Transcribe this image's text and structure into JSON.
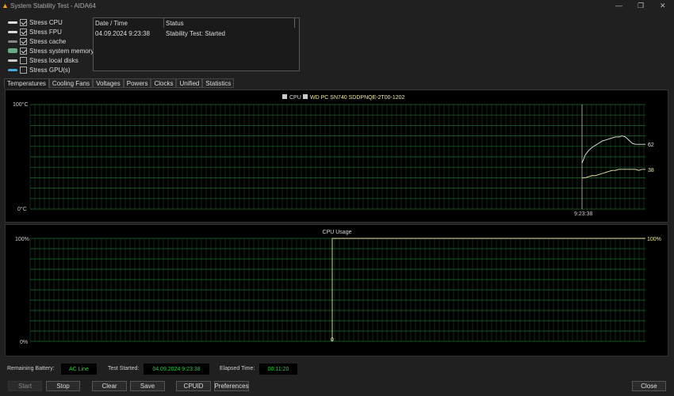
{
  "window": {
    "title": "System Stability Test - AIDA64",
    "minimize": "—",
    "restore": "❐",
    "close": "✕"
  },
  "options": [
    {
      "label": "Stress CPU",
      "checked": true,
      "icon": "cpu-icon"
    },
    {
      "label": "Stress FPU",
      "checked": true,
      "icon": "fpu-icon"
    },
    {
      "label": "Stress cache",
      "checked": true,
      "icon": "cache-icon"
    },
    {
      "label": "Stress system memory",
      "checked": true,
      "icon": "memory-icon"
    },
    {
      "label": "Stress local disks",
      "checked": false,
      "icon": "disk-icon"
    },
    {
      "label": "Stress GPU(s)",
      "checked": false,
      "icon": "gpu-icon"
    }
  ],
  "log": {
    "headers": [
      "Date / Time",
      "Status"
    ],
    "rows": [
      [
        "04.09.2024 9:23:38",
        "Stability Test: Started"
      ]
    ]
  },
  "tabs": [
    "Temperatures",
    "Cooling Fans",
    "Voltages",
    "Powers",
    "Clocks",
    "Unified",
    "Statistics"
  ],
  "chart_data": [
    {
      "type": "line",
      "legend": [
        {
          "name": "CPU",
          "checked": true,
          "color": "#ffffff"
        },
        {
          "name": "WD PC SN740 SDDPNQE-2T00-1202",
          "checked": true,
          "color": "#f0e8a0"
        }
      ],
      "ylim": [
        0,
        100
      ],
      "ytick_labels": [
        "100°C",
        "0°C"
      ],
      "x_marker": "9:23:38",
      "series": [
        {
          "name": "CPU",
          "color": "#e8e8e8",
          "end_label": "62",
          "values": [
            44,
            52,
            56,
            59,
            61,
            63,
            65,
            66,
            67,
            68,
            69,
            69,
            70,
            69,
            66,
            63,
            62,
            62,
            62,
            62
          ]
        },
        {
          "name": "WD PC SN740 SDDPNQE-2T00-1202",
          "color": "#f0e8a0",
          "end_label": "38",
          "values": [
            30,
            30,
            31,
            32,
            32,
            33,
            34,
            35,
            36,
            37,
            37,
            38,
            38,
            38,
            38,
            38,
            38,
            37,
            38,
            38
          ]
        }
      ]
    },
    {
      "type": "line",
      "title": "CPU Usage",
      "ylim": [
        0,
        100
      ],
      "ytick_labels": [
        "100%",
        "0%"
      ],
      "series": [
        {
          "color": "#e8e8a0",
          "end_label": "100%",
          "start_label": "0",
          "values": [
            0,
            100,
            100,
            100,
            100,
            100,
            100,
            100,
            100,
            100,
            100,
            100,
            100,
            100,
            100,
            100,
            100,
            100,
            100,
            100,
            100,
            100,
            100,
            100,
            100,
            100,
            100,
            100,
            100,
            100,
            100,
            100,
            100,
            100,
            100,
            100,
            100,
            100,
            100,
            100,
            100,
            100,
            100,
            100,
            100,
            100,
            100,
            100,
            100,
            100
          ]
        }
      ]
    }
  ],
  "status": {
    "battery_label": "Remaining Battery:",
    "battery_value": "AC Line",
    "started_label": "Test Started:",
    "started_value": "04.09.2024 9:23:38",
    "elapsed_label": "Elapsed Time:",
    "elapsed_value": "00:11:20"
  },
  "buttons": {
    "start": "Start",
    "stop": "Stop",
    "clear": "Clear",
    "save": "Save",
    "cpuid": "CPUID",
    "preferences": "Preferences",
    "close": "Close"
  }
}
